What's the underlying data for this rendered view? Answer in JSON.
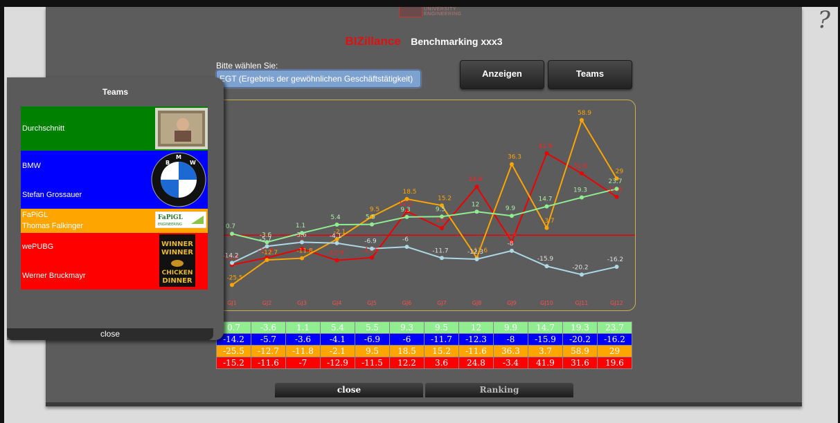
{
  "help": {
    "label": "?"
  },
  "header": {
    "brand": "BIZillance",
    "title": "Benchmarking xxx3"
  },
  "selector": {
    "label": "Bitte wählen Sie:",
    "value": "EGT (Ergebnis der gewöhnlichen Geschäftstätigkeit)"
  },
  "buttons": {
    "show": "Anzeigen",
    "teams": "Teams",
    "close": "close",
    "ranking": "Ranking"
  },
  "teams_panel": {
    "title": "Teams",
    "close": "close",
    "teams": [
      {
        "name": "Durchschnitt",
        "member": "",
        "color": "#008000",
        "image": "portrait-photo"
      },
      {
        "name": "BMW",
        "member": "Stefan Grossauer",
        "color": "#0000ff",
        "image": "bmw-logo"
      },
      {
        "name": "FaPiGL",
        "member": "Thomas Falkinger",
        "color": "#ffa500",
        "image": "fapigl-logo",
        "logo_text": "FaPiGL ENGINEERING"
      },
      {
        "name": "wePUBG",
        "member": "Werner Bruckmayr",
        "color": "#ff0000",
        "image": "winner-chicken-dinner",
        "logo_text": "WINNER WINNER CHICKEN DINNER"
      }
    ]
  },
  "chart_data": {
    "type": "line",
    "categories": [
      "GJ1",
      "GJ2",
      "GJ3",
      "GJ4",
      "GJ5",
      "GJ6",
      "GJ7",
      "GJ8",
      "GJ9",
      "GJ10",
      "GJ11",
      "GJ12"
    ],
    "ylim": [
      -30,
      62
    ],
    "zero_line": 0,
    "series": [
      {
        "name": "Durchschnitt",
        "color": "#90ee90",
        "line_color": "#90ee90",
        "label_color": "#a8f0a8",
        "values": [
          0.7,
          -3.6,
          1.1,
          5.4,
          5.5,
          9.3,
          9.5,
          12,
          9.9,
          14.7,
          19.3,
          23.7
        ]
      },
      {
        "name": "BMW",
        "color": "#0000ff",
        "line_color": "#add8e6",
        "label_color": "#e0e0e0",
        "values": [
          -14.2,
          -5.7,
          -3.6,
          -4.1,
          -6.9,
          -6,
          -11.7,
          -12.3,
          -8,
          -15.9,
          -20.2,
          -16.2
        ]
      },
      {
        "name": "FaPiGL",
        "color": "#ffa500",
        "line_color": "#ffa500",
        "label_color": "#ffa500",
        "values": [
          -25.5,
          -12.7,
          -11.8,
          -2.1,
          9.5,
          18.5,
          15.2,
          -11.6,
          36.3,
          3.7,
          58.9,
          29
        ]
      },
      {
        "name": "wePUBG",
        "color": "#ff0000",
        "line_color": "#ee0000",
        "label_color": "#ff2020",
        "values": [
          -15.2,
          -11.6,
          -7,
          -12.9,
          -11.5,
          12.2,
          3.6,
          24.8,
          -3.4,
          41.9,
          31.6,
          19.6
        ]
      }
    ],
    "grid": false
  }
}
